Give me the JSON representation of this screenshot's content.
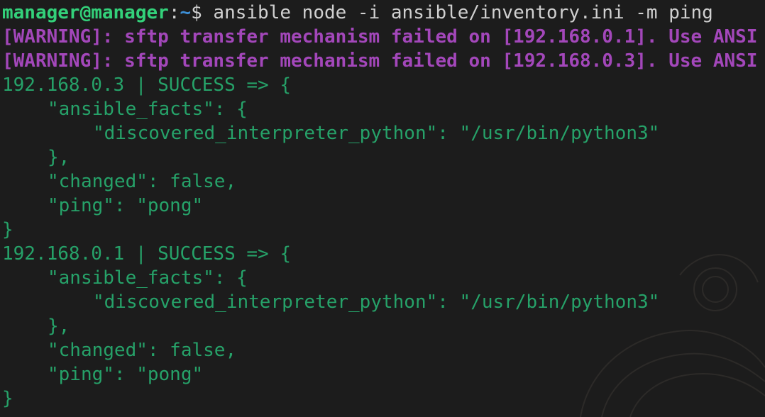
{
  "prompt": {
    "user_host": "manager@manager",
    "separator": ":",
    "path": "~",
    "symbol": "$",
    "command": " ansible node -i ansible/inventory.ini -m ping"
  },
  "warnings": [
    "[WARNING]: sftp transfer mechanism failed on [192.168.0.1]. Use ANSI",
    "[WARNING]: sftp transfer mechanism failed on [192.168.0.3]. Use ANSI"
  ],
  "results": [
    {
      "header": "192.168.0.3 | SUCCESS => {",
      "facts_open": "\"ansible_facts\": {",
      "interpreter": "\"discovered_interpreter_python\": \"/usr/bin/python3\"",
      "facts_close": "},",
      "changed": "\"changed\": false,",
      "ping": "\"ping\": \"pong\"",
      "close": "}"
    },
    {
      "header": "192.168.0.1 | SUCCESS => {",
      "facts_open": "\"ansible_facts\": {",
      "interpreter": "\"discovered_interpreter_python\": \"/usr/bin/python3\"",
      "facts_close": "},",
      "changed": "\"changed\": false,",
      "ping": "\"ping\": \"pong\"",
      "close": "}"
    }
  ]
}
